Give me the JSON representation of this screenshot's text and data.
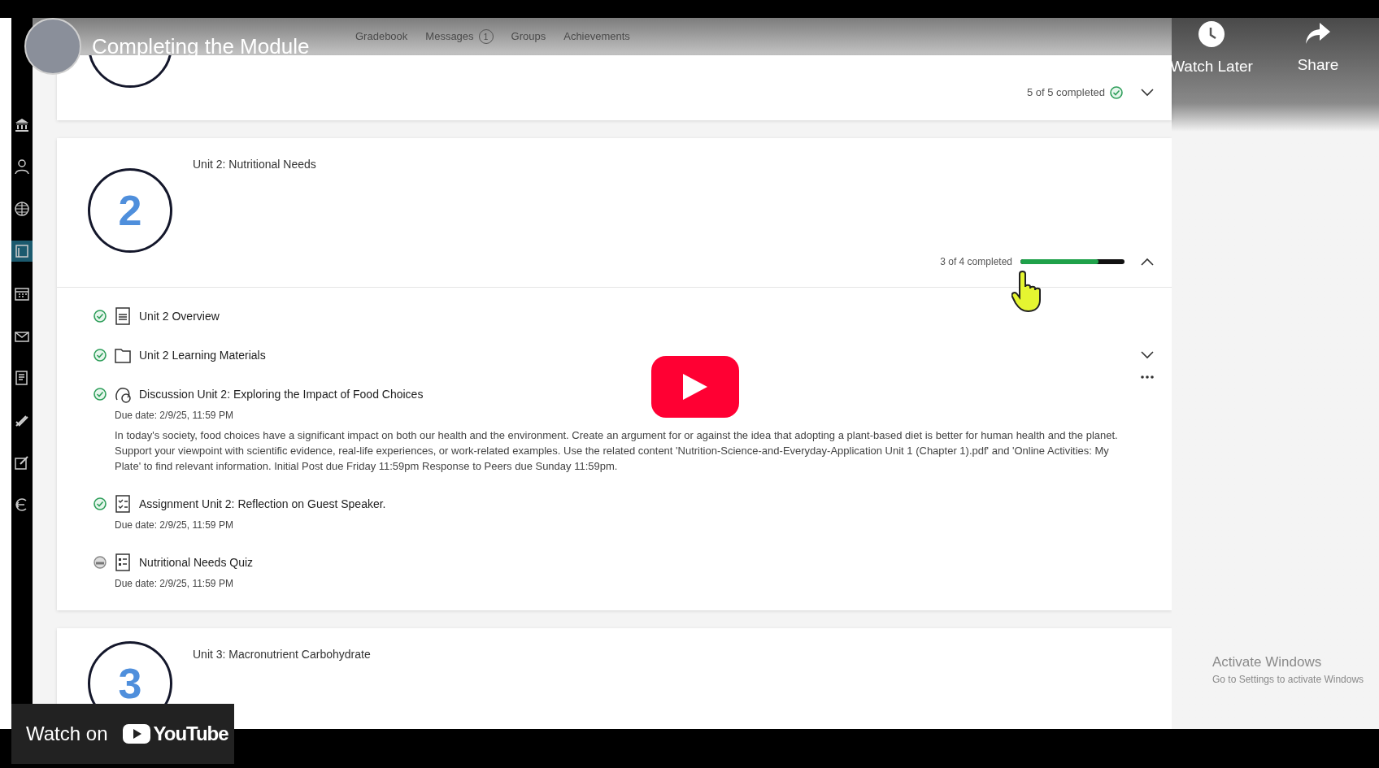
{
  "video": {
    "title": "Completing the Module",
    "watch_later": "Watch Later",
    "share": "Share",
    "watch_on": "Watch on",
    "brand": "YouTube"
  },
  "nav": [
    {
      "label": "Gradebook"
    },
    {
      "label": "Messages",
      "badge": "1"
    },
    {
      "label": "Groups"
    },
    {
      "label": "Achievements"
    }
  ],
  "sidebar": [
    {
      "kind": "institution",
      "selected": false
    },
    {
      "kind": "profile",
      "selected": false
    },
    {
      "kind": "globe",
      "selected": false
    },
    {
      "kind": "courses",
      "selected": true
    },
    {
      "kind": "calendar",
      "selected": false
    },
    {
      "kind": "messages",
      "selected": false
    },
    {
      "kind": "grades",
      "selected": false
    },
    {
      "kind": "tools",
      "selected": false
    },
    {
      "kind": "edit",
      "selected": false
    },
    {
      "kind": "signout",
      "selected": false
    }
  ],
  "modules": [
    {
      "expanded": false,
      "progress_text": "5 of 5 completed",
      "complete": true
    },
    {
      "number": "2",
      "title": "Unit 2: Nutritional Needs",
      "expanded": true,
      "progress_text": "3 of 4 completed",
      "level": 0.75,
      "items": [
        {
          "kind": "document",
          "title": "Unit 2 Overview",
          "completed": true
        },
        {
          "kind": "folder",
          "title": "Unit 2 Learning Materials",
          "completed": true,
          "expandable": true
        },
        {
          "kind": "discussion",
          "title": "Discussion Unit 2: Exploring the Impact of Food Choices",
          "completed": true,
          "menu": true,
          "due": "Due date: 2/9/25, 11:59 PM",
          "description": "In today's society, food choices have a significant impact on both our health and the environment. Create an argument for or against the idea that adopting a plant-based diet is better for human health and the planet. Support your viewpoint with scientific evidence, real-life experiences, or work-related examples. Use the related content 'Nutrition-Science-and-Everyday-Application Unit 1 (Chapter 1).pdf' and 'Online Activities: My Plate' to find relevant information. Initial Post due Friday 11:59pm Response to Peers due Sunday 11:59pm."
        },
        {
          "kind": "assignment",
          "title": "Assignment Unit 2: Reflection on Guest Speaker.",
          "completed": true,
          "due": "Due date: 2/9/25, 11:59 PM"
        },
        {
          "kind": "quiz",
          "title": "Nutritional Needs Quiz",
          "completed": false,
          "due": "Due date: 2/9/25, 11:59 PM"
        }
      ]
    },
    {
      "number": "3",
      "title": "Unit 3: Macronutrient Carbohydrate"
    }
  ],
  "watermark": {
    "title": "Activate Windows",
    "subtitle": "Go to Settings to activate Windows"
  }
}
